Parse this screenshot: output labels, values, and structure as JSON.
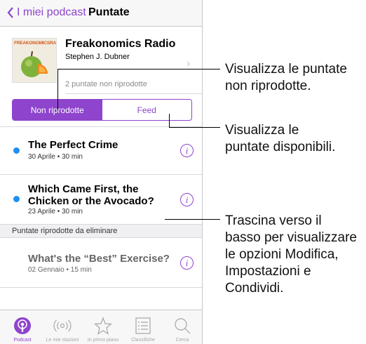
{
  "navbar": {
    "back_label": "I miei podcast",
    "title": "Puntate"
  },
  "podcast": {
    "artwork_text": "FREAKONOMICSRADIO",
    "title": "Freakonomics Radio",
    "author": "Stephen J. Dubner",
    "unplayed": "2 puntate non riprodotte"
  },
  "segment": {
    "unplayed": "Non riprodotte",
    "feed": "Feed"
  },
  "episodes": [
    {
      "title": "The Perfect Crime",
      "meta": "30 Aprile • 30 min"
    },
    {
      "title_line1": "Which Came First, the",
      "title_line2": "Chicken or the Avocado?",
      "meta": "23 Aprile • 30 min"
    }
  ],
  "section_header": "Puntate riprodotte da eliminare",
  "played": {
    "title": "What's the “Best” Exercise?",
    "meta": "02 Gennaio • 15 min"
  },
  "tabs": [
    {
      "label": "Podcast",
      "icon": "podcast-icon",
      "active": true
    },
    {
      "label": "Le mie stazioni",
      "icon": "stations-icon"
    },
    {
      "label": "In primo piano",
      "icon": "star-icon"
    },
    {
      "label": "Classifiche",
      "icon": "list-icon"
    },
    {
      "label": "Cerca",
      "icon": "search-icon"
    }
  ],
  "callouts": {
    "unplayed": [
      "Visualizza le puntate",
      "non riprodotte."
    ],
    "feed": [
      "Visualizza le",
      "puntate disponibili."
    ],
    "pulldown": [
      "Trascina verso il",
      "basso per visualizzare",
      "le opzioni Modifica,",
      "Impostazioni e",
      "Condividi."
    ]
  },
  "colors": {
    "accent": "#8e44cc",
    "unplayed_dot": "#1e90f0"
  }
}
